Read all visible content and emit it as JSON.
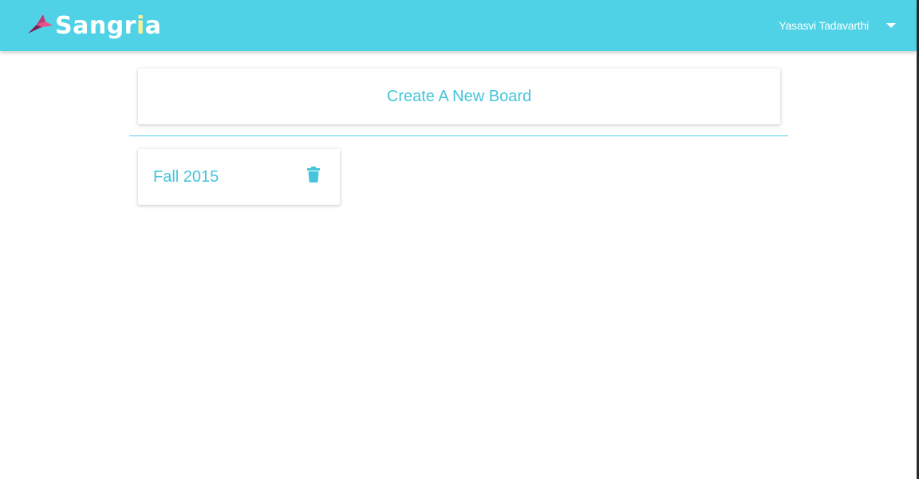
{
  "app": {
    "brand_prefix": "Sangr",
    "brand_accent": "i",
    "brand_suffix": "a",
    "header_color": "#4fd2e5",
    "accent_color": "#45c5db"
  },
  "header": {
    "user_name": "Yasasvi Tadavarthi",
    "menu_icon": "caret-down-icon"
  },
  "main": {
    "create_board_label": "Create A New Board",
    "boards": [
      {
        "title": "Fall 2015",
        "action_icon": "trash-icon"
      }
    ]
  }
}
